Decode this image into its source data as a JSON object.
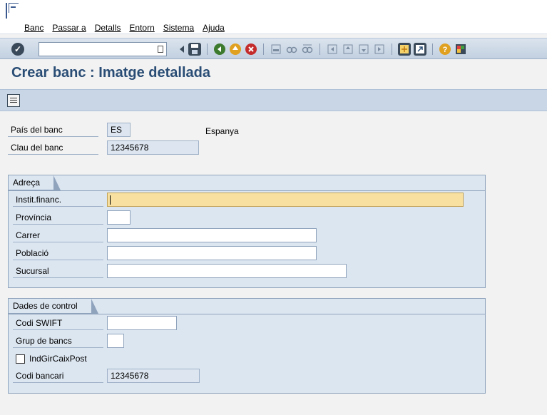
{
  "menu": {
    "items": [
      "Banc",
      "Passar a",
      "Detalls",
      "Entorn",
      "Sistema",
      "Ajuda"
    ]
  },
  "toolbar": {
    "command_field_value": "",
    "icons": [
      "enter-icon",
      "back-icon",
      "save-icon",
      "back-nav-icon",
      "exit-icon",
      "cancel-icon",
      "print-icon",
      "find-icon",
      "find-next-icon",
      "first-page-icon",
      "prev-page-icon",
      "next-page-icon",
      "last-page-icon",
      "new-session-icon",
      "shortcut-icon",
      "help-icon",
      "layout-icon"
    ]
  },
  "page": {
    "title": "Crear banc : Imatge detallada"
  },
  "header_fields": {
    "country_label": "País del banc",
    "country_value": "ES",
    "country_name": "Espanya",
    "bank_key_label": "Clau del banc",
    "bank_key_value": "12345678"
  },
  "address_group": {
    "title": "Adreça",
    "fields": {
      "institution_label": "Instit.financ.",
      "institution_value": "",
      "province_label": "Província",
      "province_value": "",
      "street_label": "Carrer",
      "street_value": "",
      "city_label": "Població",
      "city_value": "",
      "branch_label": "Sucursal",
      "branch_value": ""
    }
  },
  "control_group": {
    "title": "Dades de control",
    "fields": {
      "swift_label": "Codi SWIFT",
      "swift_value": "",
      "bank_group_label": "Grup de bancs",
      "bank_group_value": "",
      "postbank_label": "IndGirCaixPost",
      "postbank_checked": false,
      "bank_code_label": "Codi bancari",
      "bank_code_value": "12345678"
    }
  }
}
